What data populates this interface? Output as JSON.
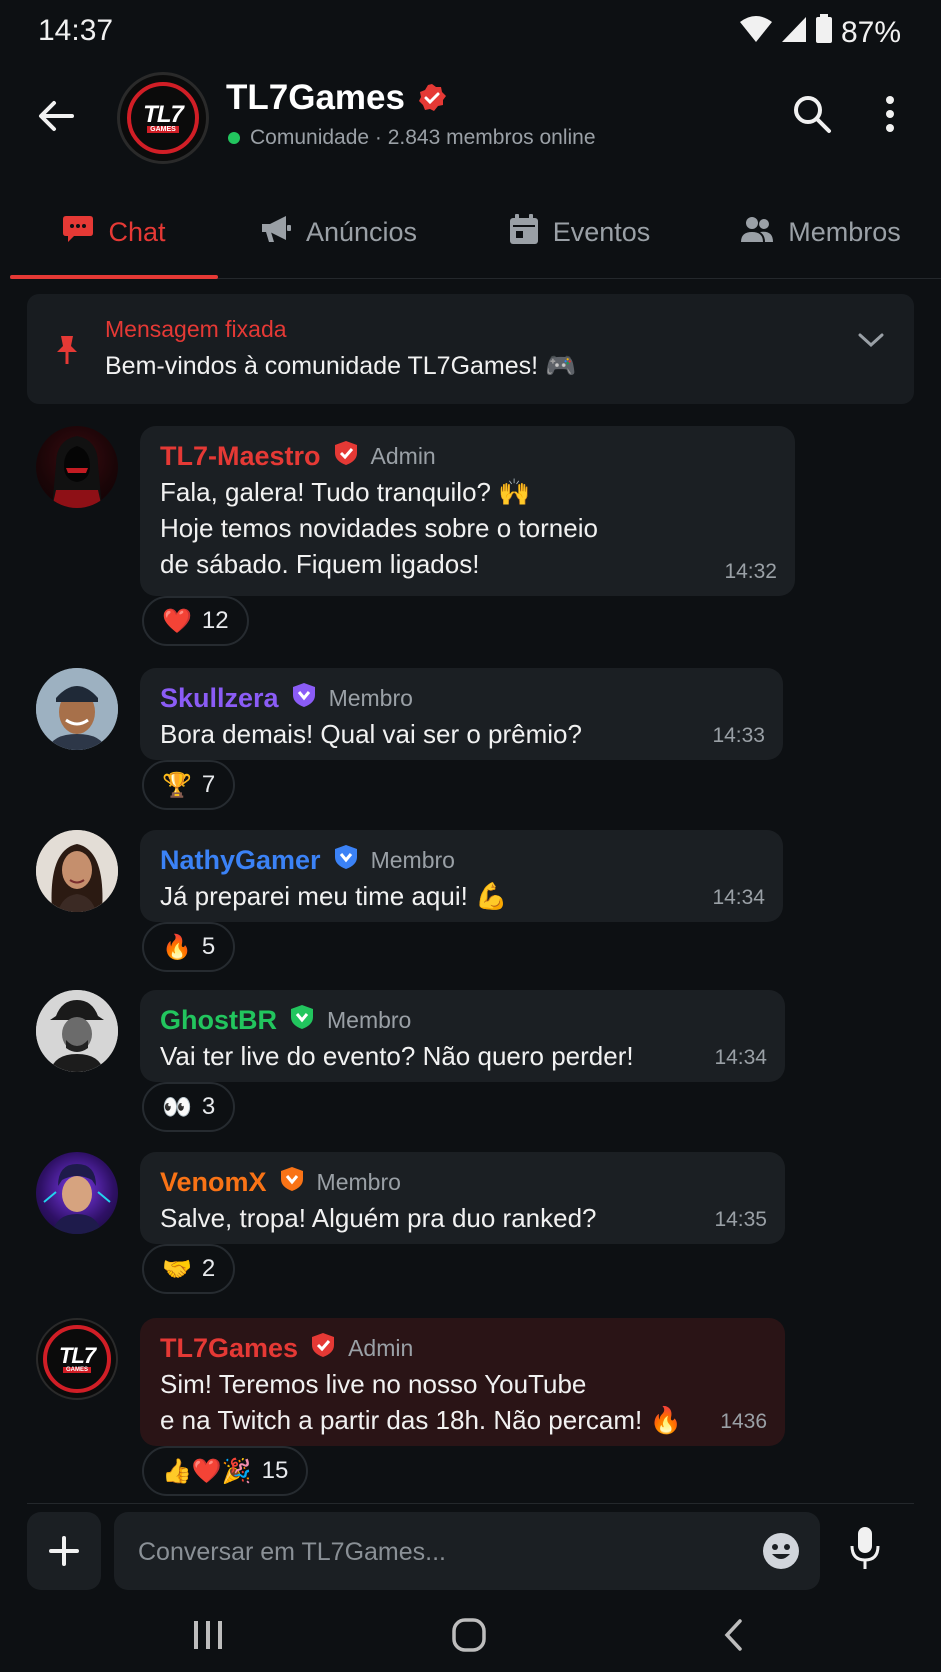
{
  "status": {
    "time": "14:37",
    "battery": "87%"
  },
  "header": {
    "logo_text": "TL7",
    "logo_sub": "GAMES",
    "title": "TL7Games",
    "subtitle": "Comunidade · 2.843 membros online"
  },
  "tabs": [
    {
      "label": "Chat",
      "icon": "chat-bubble-icon",
      "active": true
    },
    {
      "label": "Anúncios",
      "icon": "megaphone-icon",
      "active": false
    },
    {
      "label": "Eventos",
      "icon": "calendar-icon",
      "active": false
    },
    {
      "label": "Membros",
      "icon": "people-icon",
      "active": false
    }
  ],
  "pinned": {
    "label": "Mensagem fixada",
    "text": "Bem-vindos à comunidade TL7Games! 🎮"
  },
  "messages": [
    {
      "name": "TL7-Maestro",
      "role": "Admin",
      "text": "Fala, galera! Tudo tranquilo? 🙌\nHoje temos novidades sobre o torneio\nde sábado. Fiquem ligados!",
      "time": "14:32",
      "reaction": "❤️",
      "count": "12",
      "color": "#e53935"
    },
    {
      "name": "Skullzera",
      "role": "Membro",
      "text": "Bora demais! Qual vai ser o prêmio?",
      "time": "14:33",
      "reaction": "🏆",
      "count": "7",
      "color": "#8b5cf6"
    },
    {
      "name": "NathyGamer",
      "role": "Membro",
      "text": "Já preparei meu time aqui! 💪",
      "time": "14:34",
      "reaction": "🔥",
      "count": "5",
      "color": "#3b82f6"
    },
    {
      "name": "GhostBR",
      "role": "Membro",
      "text": "Vai ter live do evento? Não quero perder!",
      "time": "14:34",
      "reaction": "👀",
      "count": "3",
      "color": "#22c55e"
    },
    {
      "name": "VenomX",
      "role": "Membro",
      "text": "Salve, tropa! Alguém pra duo ranked?",
      "time": "14:35",
      "reaction": "🤝",
      "count": "2",
      "color": "#f97316"
    },
    {
      "name": "TL7Games",
      "role": "Admin",
      "text": "Sim! Teremos live no nosso YouTube\ne na Twitch a partir das 18h. Não percam! 🔥",
      "time": "1436",
      "reaction": "👍❤️🎉",
      "count": "15",
      "color": "#e53935"
    }
  ],
  "composer": {
    "placeholder": "Conversar em TL7Games..."
  }
}
